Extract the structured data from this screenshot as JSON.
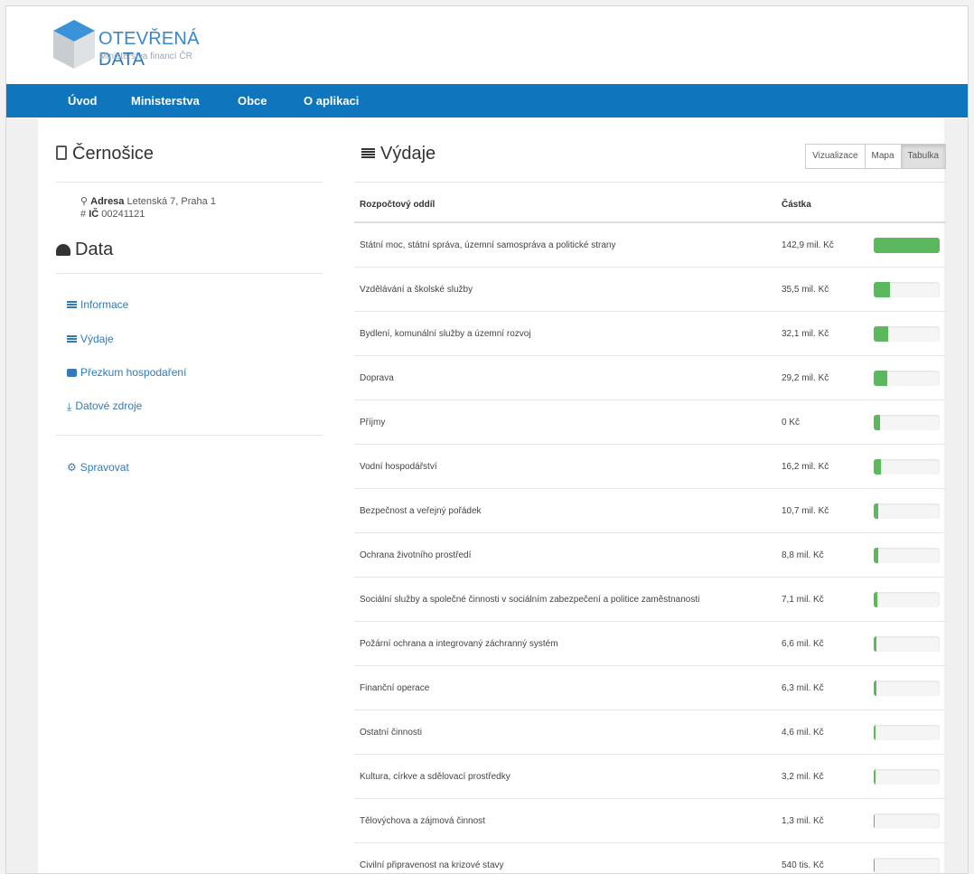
{
  "brand": {
    "title_main": "OTEVŘENÁ",
    "title_rest": "DATA",
    "subtitle": "Ministerstva financí ČR",
    "accent_color": "#0f75bd"
  },
  "nav": {
    "items": [
      {
        "label": "Úvod"
      },
      {
        "label": "Ministerstva"
      },
      {
        "label": "Obce"
      },
      {
        "label": "O aplikaci"
      }
    ]
  },
  "sidebar": {
    "city": "Černošice",
    "address_label": "Adresa",
    "address_value": "Letenská 7, Praha 1",
    "ic_label": "IČ",
    "ic_value": "00241121",
    "data_heading": "Data",
    "menu": [
      {
        "label": "Informace",
        "icon": "list-icon"
      },
      {
        "label": "Výdaje",
        "icon": "list-icon"
      },
      {
        "label": "Přezkum hospodaření",
        "icon": "save-icon"
      },
      {
        "label": "Datové zdroje",
        "icon": "download-icon"
      }
    ],
    "admin": {
      "label": "Spravovat",
      "icon": "gear-icon"
    }
  },
  "main": {
    "heading": "Výdaje",
    "view_buttons": [
      {
        "label": "Vizualizace",
        "active": false
      },
      {
        "label": "Mapa",
        "active": false
      },
      {
        "label": "Tabulka",
        "active": true
      }
    ],
    "table": {
      "headers": [
        "Rozpočtový oddíl",
        "Částka"
      ],
      "rows": [
        {
          "category": "Státní moc, státní správa, územní samospráva a politické strany",
          "amount": "142,9 mil. Kč",
          "share": 1.0
        },
        {
          "category": "Vzdělávání a školské služby",
          "amount": "35,5 mil. Kč",
          "share": 0.25
        },
        {
          "category": "Bydlení, komunální služby a územní rozvoj",
          "amount": "32,1 mil. Kč",
          "share": 0.22
        },
        {
          "category": "Doprava",
          "amount": "29,2 mil. Kč",
          "share": 0.2
        },
        {
          "category": "Příjmy",
          "amount": "0 Kč",
          "share": 0.1
        },
        {
          "category": "Vodní hospodářství",
          "amount": "16,2 mil. Kč",
          "share": 0.11
        },
        {
          "category": "Bezpečnost a veřejný pořádek",
          "amount": "10,7 mil. Kč",
          "share": 0.075
        },
        {
          "category": "Ochrana životního prostředí",
          "amount": "8,8 mil. Kč",
          "share": 0.062
        },
        {
          "category": "Sociální služby a společné činnosti v sociálním zabezpečení a politice zaměstnanosti",
          "amount": "7,1 mil. Kč",
          "share": 0.05
        },
        {
          "category": "Požární ochrana a integrovaný záchranný systém",
          "amount": "6,6 mil. Kč",
          "share": 0.046
        },
        {
          "category": "Finanční operace",
          "amount": "6,3 mil. Kč",
          "share": 0.044
        },
        {
          "category": "Ostatní činnosti",
          "amount": "4,6 mil. Kč",
          "share": 0.032
        },
        {
          "category": "Kultura, církve a sdělovací prostředky",
          "amount": "3,2 mil. Kč",
          "share": 0.022
        },
        {
          "category": "Tělovýchova a zájmová činnost",
          "amount": "1,3 mil. Kč",
          "share": 0.009
        },
        {
          "category": "Civilní připravenost na krizové stavy",
          "amount": "540 tis. Kč",
          "share": 0.004
        }
      ]
    }
  }
}
